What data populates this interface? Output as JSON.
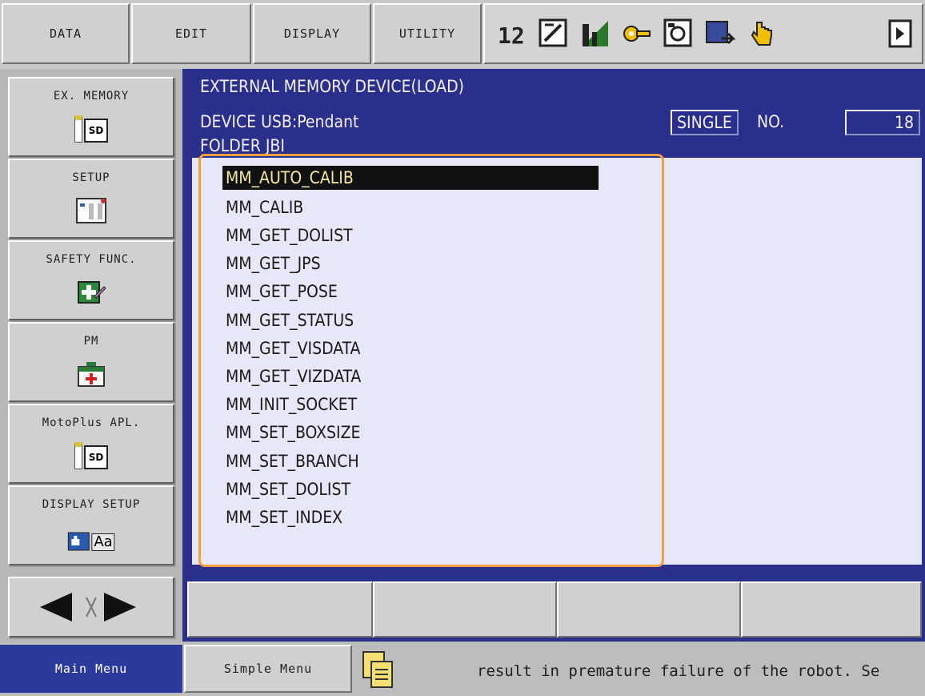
{
  "top_menu": {
    "items": [
      "DATA",
      "EDIT",
      "DISPLAY",
      "UTILITY"
    ]
  },
  "toolbar_icons": [
    "robot-coordinates-icon",
    "job-edit-icon",
    "signal-icon",
    "key-icon",
    "teaching-icon",
    "screen-switch-icon",
    "hand-icon",
    "next-page-icon"
  ],
  "left_menu": {
    "items": [
      {
        "label": "EX. MEMORY",
        "icon": "sd-card-icon"
      },
      {
        "label": "SETUP",
        "icon": "setup-panel-icon"
      },
      {
        "label": "SAFETY FUNC.",
        "icon": "safety-icon"
      },
      {
        "label": "PM",
        "icon": "medical-kit-icon"
      },
      {
        "label": "MotoPlus APL.",
        "icon": "sd-card-icon"
      },
      {
        "label": "DISPLAY SETUP",
        "icon": "display-setup-icon"
      }
    ],
    "icon_text": {
      "sd": "SD",
      "aa": "Aa"
    }
  },
  "screen": {
    "title": "EXTERNAL MEMORY DEVICE(LOAD)",
    "device": "DEVICE USB:Pendant",
    "folder": "FOLDER JBI",
    "mode": "SINGLE",
    "no_label": "NO.",
    "no_value": "18",
    "selected_index": 0,
    "files": [
      "MM_AUTO_CALIB",
      "MM_CALIB",
      "MM_GET_DOLIST",
      "MM_GET_JPS",
      "MM_GET_POSE",
      "MM_GET_STATUS",
      "MM_GET_VISDATA",
      "MM_GET_VIZDATA",
      "MM_INIT_SOCKET",
      "MM_SET_BOXSIZE",
      "MM_SET_BRANCH",
      "MM_SET_DOLIST",
      "MM_SET_INDEX"
    ]
  },
  "status": {
    "main_menu": "Main Menu",
    "simple_menu": "Simple Menu",
    "message": "result in premature failure of the robot. Se"
  },
  "colors": {
    "panel_blue": "#2b2f8c",
    "screen_bg": "#e6e8f8",
    "highlight_orange": "#f0a040",
    "main_menu_bg": "#2c3a9c"
  }
}
